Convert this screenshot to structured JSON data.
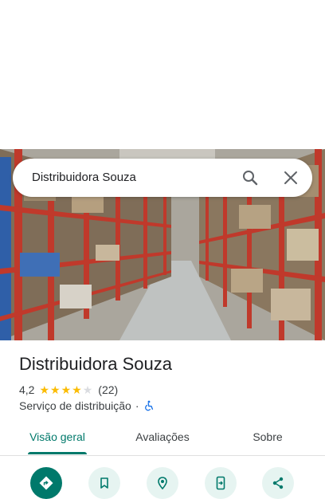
{
  "search": {
    "query": "Distribuidora Souza"
  },
  "place": {
    "name": "Distribuidora Souza",
    "rating": "4,2",
    "stars": 4,
    "reviews_count": "(22)",
    "category": "Serviço de distribuição",
    "separator": "·",
    "accessibility_icon": "wheelchair-icon"
  },
  "tabs": [
    {
      "label": "Visão geral",
      "active": true
    },
    {
      "label": "Avaliações",
      "active": false
    },
    {
      "label": "Sobre",
      "active": false
    }
  ],
  "actions": [
    {
      "icon": "directions-icon"
    },
    {
      "icon": "bookmark-icon"
    },
    {
      "icon": "nearby-icon"
    },
    {
      "icon": "send-to-phone-icon"
    },
    {
      "icon": "share-icon"
    }
  ],
  "colors": {
    "accent": "#00796b",
    "star": "#fbbc04",
    "action_bg": "#e6f4f1"
  }
}
